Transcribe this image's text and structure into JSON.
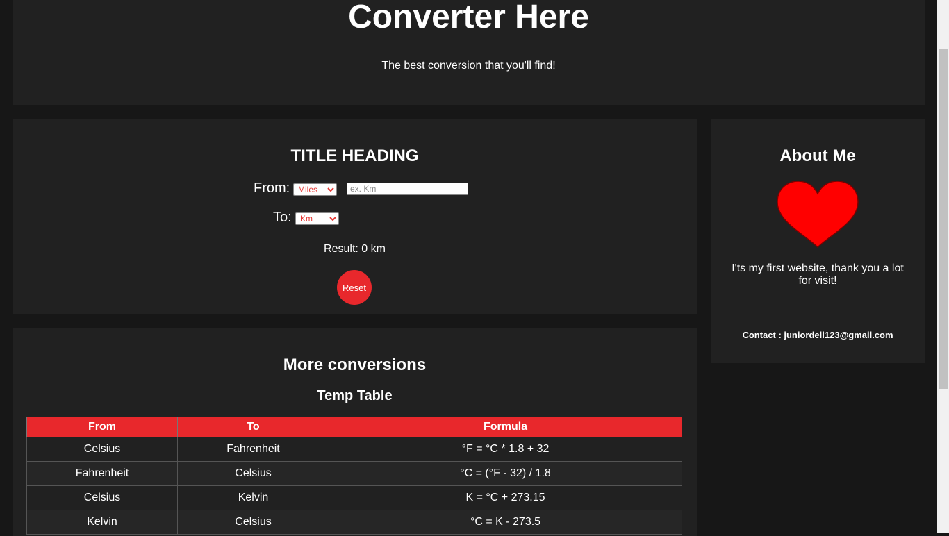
{
  "header": {
    "title": "Converter Here",
    "tagline": "The best conversion that you'll find!"
  },
  "converter": {
    "heading": "TITLE HEADING",
    "from_label": "From:",
    "from_unit": "Miles",
    "value_placeholder": "ex. Km",
    "to_label": "To:",
    "to_unit": "Km",
    "result": "Result: 0 km",
    "reset_label": "Reset"
  },
  "about": {
    "heading": "About Me",
    "image_icon": "heart-icon",
    "bio": "I'ts my first website, thank you a lot for visit!",
    "contact": "Contact : juniordell123@gmail.com"
  },
  "more": {
    "heading": "More conversions",
    "table_title": "Temp Table",
    "columns": [
      "From",
      "To",
      "Formula"
    ],
    "rows": [
      [
        "Celsius",
        "Fahrenheit",
        "°F = °C * 1.8 + 32"
      ],
      [
        "Fahrenheit",
        "Celsius",
        "°C = (°F - 32) / 1.8"
      ],
      [
        "Celsius",
        "Kelvin",
        "K = °C + 273.15"
      ],
      [
        "Kelvin",
        "Celsius",
        "°C = K - 273.5"
      ]
    ]
  },
  "colors": {
    "accent": "#e8282c",
    "card": "#212121",
    "background": "#171717"
  }
}
